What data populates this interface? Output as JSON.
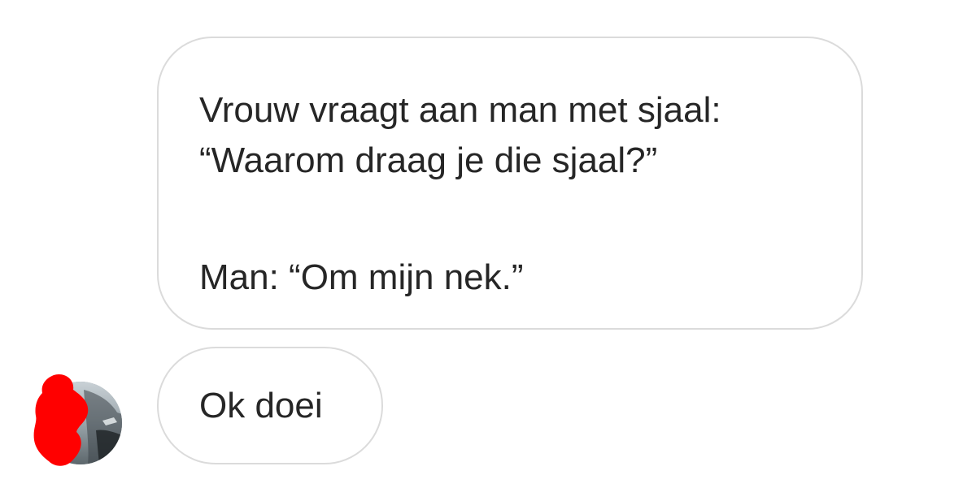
{
  "messages": [
    {
      "lines": [
        "Vrouw vraagt aan man met sjaal:",
        "“Waarom draag je die sjaal?”",
        "Man: “Om mijn nek.”"
      ]
    },
    {
      "lines": [
        "Ok doei"
      ]
    }
  ],
  "colors": {
    "bubble_border": "#dbdbdb",
    "text": "#262626",
    "redaction": "#ff0000"
  },
  "icons": {
    "avatar": "profile-photo-redacted"
  }
}
